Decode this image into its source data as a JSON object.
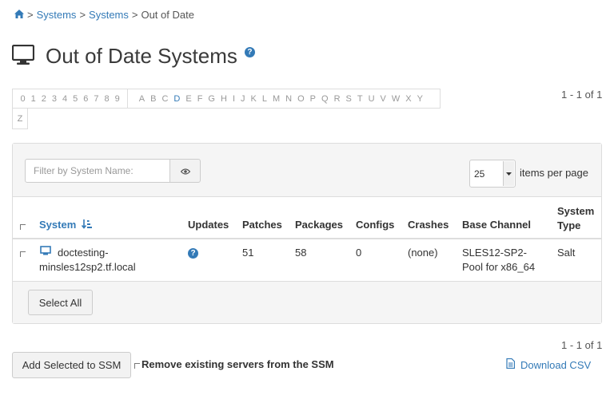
{
  "breadcrumb": {
    "items": [
      "Systems",
      "Systems"
    ],
    "separator": ">",
    "current": "Out of Date"
  },
  "page": {
    "title": "Out of Date Systems",
    "help": "?"
  },
  "alphabar": {
    "digits": [
      "0",
      "1",
      "2",
      "3",
      "4",
      "5",
      "6",
      "7",
      "8",
      "9"
    ],
    "letters": [
      "A",
      "B",
      "C",
      "D",
      "E",
      "F",
      "G",
      "H",
      "I",
      "J",
      "K",
      "L",
      "M",
      "N",
      "O",
      "P",
      "Q",
      "R",
      "S",
      "T",
      "U",
      "V",
      "W",
      "X",
      "Y"
    ],
    "wrapped_letter": "Z",
    "active": "D"
  },
  "pager": {
    "top": "1 - 1 of 1",
    "bottom": "1 - 1 of 1"
  },
  "filter": {
    "placeholder": "Filter by System Name:",
    "per_page_value": "25",
    "per_page_label": "items per page"
  },
  "table": {
    "columns": {
      "system": "System",
      "updates": "Updates",
      "patches": "Patches",
      "packages": "Packages",
      "configs": "Configs",
      "crashes": "Crashes",
      "base_channel": "Base Channel",
      "system_type_1": "System",
      "system_type_2": "Type"
    },
    "rows": [
      {
        "system_line1": "doctesting-",
        "system_line2": "minsles12sp2.tf.local",
        "updates_icon": "?",
        "patches": "51",
        "packages": "58",
        "configs": "0",
        "crashes": "(none)",
        "base_channel_line1": "SLES12-SP2-",
        "base_channel_line2": "Pool for x86_64",
        "system_type": "Salt"
      }
    ],
    "select_all": "Select All"
  },
  "footer": {
    "add_ssm": "Add Selected to SSM",
    "remove_ssm": "Remove existing servers from the SSM",
    "download_csv": "Download CSV"
  },
  "colors": {
    "link": "#337ab7",
    "panel_bg": "#f5f5f5",
    "border": "#dddddd"
  },
  "icons": [
    "home-icon",
    "monitor-icon",
    "help-icon",
    "eye-icon",
    "sort-icon",
    "system-icon",
    "csv-file-icon"
  ]
}
